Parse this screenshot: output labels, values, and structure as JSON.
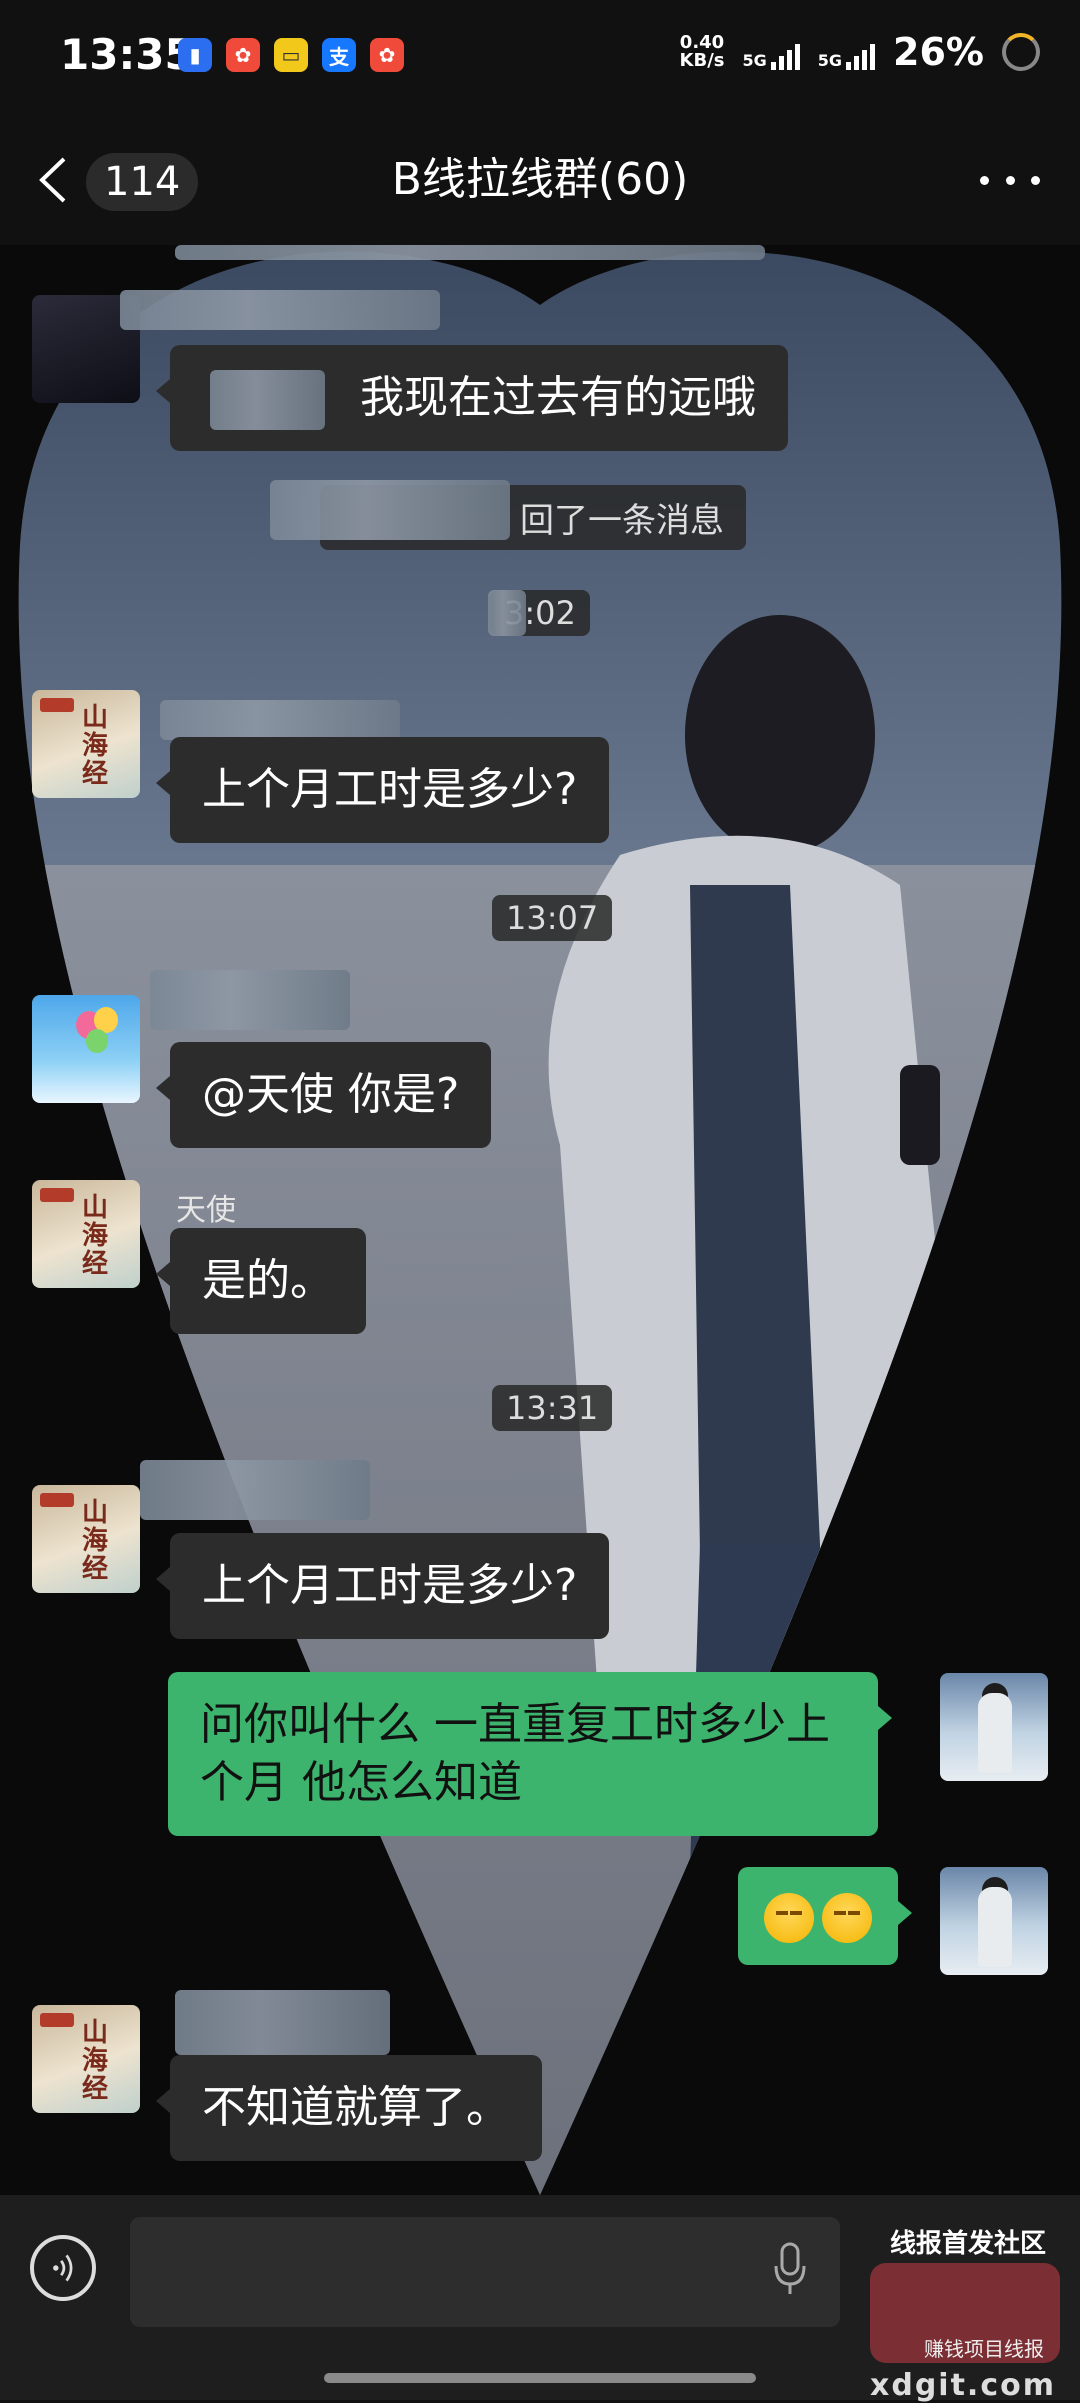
{
  "status_bar": {
    "time": "13:35",
    "net_speed_value": "0.40",
    "net_speed_unit": "KB/s",
    "sim1_label": "5G",
    "sim2_label": "5G",
    "battery": "26%",
    "app_icons": [
      "phone-app-icon",
      "pinduoduo-icon",
      "app-icon-yellow",
      "alipay-icon",
      "pinduoduo-icon-2"
    ],
    "alipay_char": "支"
  },
  "header": {
    "unread_count": "114",
    "title": "B线拉线群(60)"
  },
  "messages": {
    "m1_text": "我现在过去有的远哦",
    "recall_text": "回了一条消息",
    "ts1": "3:02",
    "m2_text": "上个月工时是多少?",
    "ts2": "13:07",
    "m3_text": "@天使  你是?",
    "m4_sender": "天使",
    "m4_text": "是的。",
    "ts3": "13:31",
    "m5_text": "上个月工时是多少?",
    "m6_text": "问你叫什么 一直重复工时多少上个月 他怎么知道",
    "m8_text": "不知道就算了。"
  },
  "avatars": {
    "mountain_text": "山海经"
  },
  "input_bar": {
    "placeholder": ""
  },
  "watermark": {
    "title": "线报首发社区",
    "sub": "赚钱项目线报",
    "domain": "xdgit.com"
  },
  "colors": {
    "outgoing_bubble": "#3db46d",
    "incoming_bubble": "#2c2c2c",
    "background": "#111111"
  }
}
